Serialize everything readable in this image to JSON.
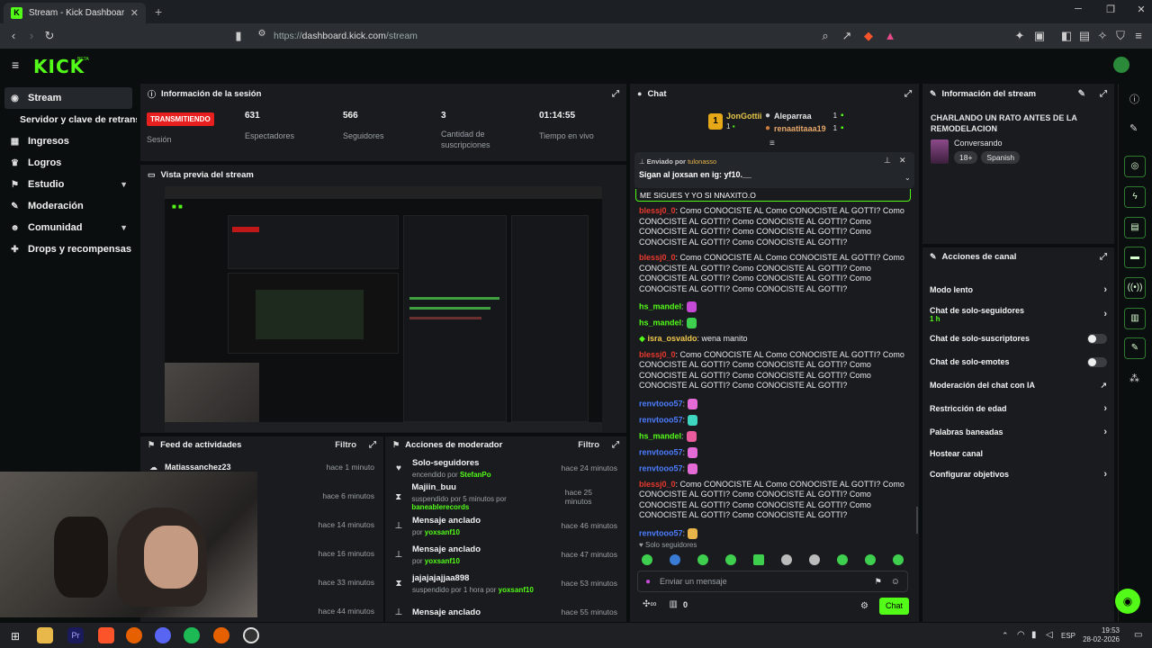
{
  "browser": {
    "tab_title": "Stream - Kick Dashboard",
    "url_prefix": "https://",
    "url_host": "dashboard.kick.com",
    "url_path": "/stream"
  },
  "app": {
    "logo": "KICK",
    "beta": "BETA"
  },
  "sidebar": {
    "items": [
      {
        "label": "Stream",
        "icon": "stream-icon"
      },
      {
        "label": "Servidor y clave de retransm",
        "icon": ""
      },
      {
        "label": "Ingresos",
        "icon": "bars-icon"
      },
      {
        "label": "Logros",
        "icon": "trophy-icon"
      },
      {
        "label": "Estudio",
        "icon": "studio-icon"
      },
      {
        "label": "Moderación",
        "icon": "wrench-icon"
      },
      {
        "label": "Comunidad",
        "icon": "users-icon"
      },
      {
        "label": "Drops y recompensas",
        "icon": "gift-icon"
      }
    ]
  },
  "session": {
    "title": "Información de la sesión",
    "live_badge": "TRANSMITIENDO",
    "live_label": "Sesión",
    "stats": [
      {
        "value": "631",
        "label": "Espectadores"
      },
      {
        "value": "566",
        "label": "Seguidores"
      },
      {
        "value": "3",
        "label": "Cantidad de suscripciones"
      },
      {
        "value": "01:14:55",
        "label": "Tiempo en vivo"
      }
    ]
  },
  "preview": {
    "title": "Vista previa del stream"
  },
  "feed": {
    "title": "Feed de actividades",
    "filter": "Filtro",
    "rows": [
      {
        "name": "Matiassanchez23",
        "time": "hace 1 minuto"
      },
      {
        "name": "",
        "time": "hace 6 minutos"
      },
      {
        "name": "",
        "time": "hace 14 minutos"
      },
      {
        "name": "",
        "time": "hace 16 minutos"
      },
      {
        "name": "",
        "time": "hace 33 minutos"
      },
      {
        "name": "",
        "time": "hace 44 minutos"
      }
    ]
  },
  "mod": {
    "title": "Acciones de moderador",
    "filter": "Filtro",
    "rows": [
      {
        "title": "Solo-seguidores",
        "sub": "encendido por",
        "by": "StefanPo",
        "time": "hace 24 minutos",
        "icon": "heart-icon"
      },
      {
        "title": "Majiin_buu",
        "sub": "suspendido por 5 minutos por",
        "by": "baneablerecords",
        "time": "hace 25 minutos",
        "icon": "hourglass-icon"
      },
      {
        "title": "Mensaje anclado",
        "sub": "por",
        "by": "yoxsanf10",
        "time": "hace 46 minutos",
        "icon": "pin-icon"
      },
      {
        "title": "Mensaje anclado",
        "sub": "por",
        "by": "yoxsanf10",
        "time": "hace 47 minutos",
        "icon": "pin-icon"
      },
      {
        "title": "jajajajajjaa898",
        "sub": "suspendido por 1 hora por",
        "by": "yoxsanf10",
        "time": "hace 53 minutos",
        "icon": "hourglass-icon"
      },
      {
        "title": "Mensaje anclado",
        "sub": "",
        "by": "",
        "time": "hace 55 minutos",
        "icon": "pin-icon"
      }
    ]
  },
  "chat": {
    "title": "Chat",
    "leaderboard": [
      {
        "rank": "1",
        "name": "JonGottii",
        "count": "1"
      },
      {
        "name": "Aleparraa",
        "count": "1"
      },
      {
        "name": "renaatitaaa19",
        "count": "1"
      }
    ],
    "pinned": {
      "by_label": "Enviado por",
      "by": "tulonasso",
      "text": "Sigan al joxsan en ig: yf10.__"
    },
    "overlap_text": "ME SIGUES Y YO SI NNAXITO.O",
    "messages": [
      {
        "user": "blessj0_0",
        "color": "#e8392f",
        "text": "Como CONOCISTE AL Como CONOCISTE AL GOTTI? Como CONOCISTE AL GOTTI? Como CONOCISTE AL GOTTI? Como CONOCISTE AL GOTTI? Como CONOCISTE AL GOTTI? Como CONOCISTE AL GOTTI? Como CONOCISTE AL GOTTI?",
        "emote": ""
      },
      {
        "user": "blessj0_0",
        "color": "#e8392f",
        "text": "Como CONOCISTE AL Como CONOCISTE AL GOTTI? Como CONOCISTE AL GOTTI? Como CONOCISTE AL GOTTI? Como CONOCISTE AL GOTTI? Como CONOCISTE AL GOTTI? Como CONOCISTE AL GOTTI? Como CONOCISTE AL GOTTI?",
        "emote": ""
      },
      {
        "user": "hs_mandel",
        "color": "#53fc18",
        "text": "",
        "emote": "#c54bd6"
      },
      {
        "user": "hs_mandel",
        "color": "#53fc18",
        "text": "",
        "emote": "#3fcf4e"
      },
      {
        "user": "isra_osvaldo",
        "color": "#f2c94c",
        "text": "wena manito",
        "emote": ""
      },
      {
        "user": "blessj0_0",
        "color": "#e8392f",
        "text": "Como CONOCISTE AL Como CONOCISTE AL GOTTI? Como CONOCISTE AL GOTTI? Como CONOCISTE AL GOTTI? Como CONOCISTE AL GOTTI? Como CONOCISTE AL GOTTI? Como CONOCISTE AL GOTTI? Como CONOCISTE AL GOTTI?",
        "emote": ""
      },
      {
        "user": "renvtooo57",
        "color": "#4d7cff",
        "text": "",
        "emote": "#e46bd6"
      },
      {
        "user": "renvtooo57",
        "color": "#4d7cff",
        "text": "",
        "emote": "#3fd6c0"
      },
      {
        "user": "hs_mandel",
        "color": "#53fc18",
        "text": "",
        "emote": "#e85b9d"
      },
      {
        "user": "renvtooo57",
        "color": "#4d7cff",
        "text": "",
        "emote": "#e46bd6"
      },
      {
        "user": "renvtooo57",
        "color": "#4d7cff",
        "text": "",
        "emote": "#e46bd6"
      },
      {
        "user": "blessj0_0",
        "color": "#e8392f",
        "text": "Como CONOCISTE AL Como CONOCISTE AL GOTTI? Como CONOCISTE AL GOTTI? Como CONOCISTE AL GOTTI? Como CONOCISTE AL GOTTI? Como CONOCISTE AL GOTTI? Como CONOCISTE AL GOTTI? Como CONOCISTE AL GOTTI?",
        "emote": ""
      },
      {
        "user": "renvtooo57",
        "color": "#4d7cff",
        "text": "",
        "emote": "#e8b54b"
      }
    ],
    "followers_only": "Solo seguidores",
    "input_placeholder": "Enviar un mensaje",
    "points": "0",
    "send_label": "Chat"
  },
  "stream_info": {
    "title": "Información del stream",
    "stream_title": "CHARLANDO UN RATO ANTES DE LA REMODELACION",
    "category": "Conversando",
    "tags": [
      "18+",
      "Spanish"
    ]
  },
  "channel_actions": {
    "title": "Acciones de canal",
    "items": [
      {
        "label": "Modo lento",
        "sub": "",
        "control": "chevron"
      },
      {
        "label": "Chat de solo-seguidores",
        "sub": "1 h",
        "control": "chevron"
      },
      {
        "label": "Chat de solo-suscriptores",
        "sub": "",
        "control": "toggle"
      },
      {
        "label": "Chat de solo-emotes",
        "sub": "",
        "control": "toggle"
      },
      {
        "label": "Moderación del chat con IA",
        "sub": "",
        "control": "external"
      },
      {
        "label": "Restricción de edad",
        "sub": "",
        "control": "chevron"
      },
      {
        "label": "Palabras baneadas",
        "sub": "",
        "control": "chevron"
      },
      {
        "label": "Hostear canal",
        "sub": "",
        "control": "none"
      },
      {
        "label": "Configurar objetivos",
        "sub": "",
        "control": "chevron"
      }
    ]
  },
  "taskbar": {
    "lang": "ESP",
    "time": "19:53",
    "date": "28-02-2026"
  },
  "colors": {
    "brand": "#53fc18",
    "live": "#e81f1f",
    "panel": "#191b1f"
  }
}
